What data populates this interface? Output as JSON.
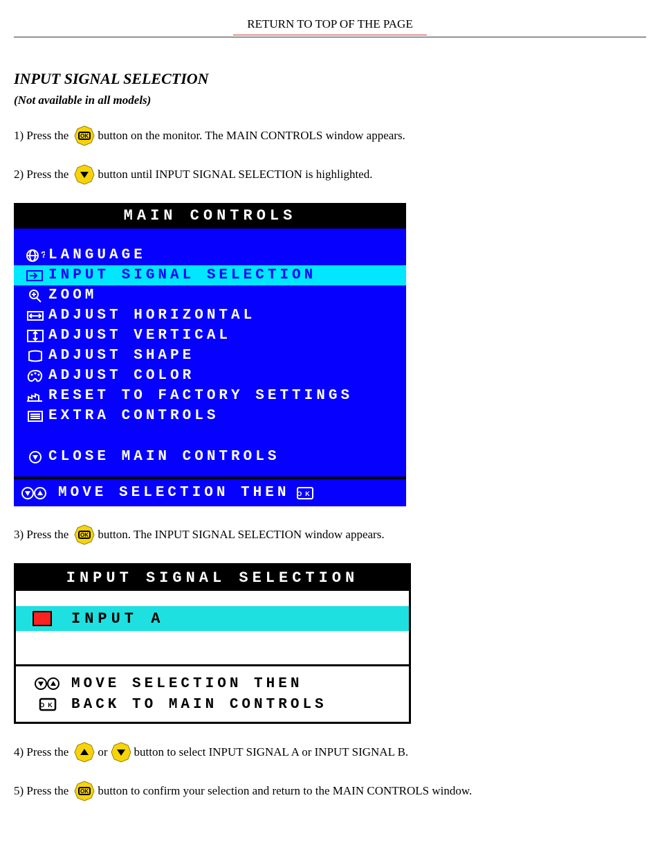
{
  "top_link": "RETURN TO TOP OF THE PAGE",
  "section": {
    "title": "INPUT SIGNAL SELECTION",
    "note": "(Not available in all models)"
  },
  "steps": {
    "s1a": "1) Press the ",
    "s1b": " button on the monitor. The MAIN CONTROLS window appears.",
    "s2a": "2) Press the ",
    "s2b": " button until INPUT SIGNAL SELECTION is highlighted.",
    "s3a": "3) Press the ",
    "s3b": " button. The INPUT SIGNAL SELECTION window appears.",
    "s4a": "4) Press the ",
    "s4b": " or ",
    "s4c": " button to select INPUT SIGNAL A or INPUT SIGNAL B.",
    "s5a": "5) Press the ",
    "s5b": " button to confirm your selection and return to the MAIN CONTROLS window."
  },
  "osd_main": {
    "title": "MAIN CONTROLS",
    "items": [
      {
        "label": "LANGUAGE"
      },
      {
        "label": "INPUT SIGNAL SELECTION",
        "selected": true
      },
      {
        "label": "ZOOM"
      },
      {
        "label": "ADJUST HORIZONTAL"
      },
      {
        "label": "ADJUST VERTICAL"
      },
      {
        "label": "ADJUST SHAPE"
      },
      {
        "label": "ADJUST COLOR"
      },
      {
        "label": "RESET TO FACTORY SETTINGS"
      },
      {
        "label": "EXTRA CONTROLS"
      }
    ],
    "close": "CLOSE MAIN CONTROLS",
    "footer": "MOVE SELECTION THEN"
  },
  "osd_sel": {
    "title": "INPUT SIGNAL SELECTION",
    "option": "INPUT A",
    "footer1": "MOVE SELECTION THEN",
    "footer2": "BACK TO MAIN CONTROLS"
  }
}
